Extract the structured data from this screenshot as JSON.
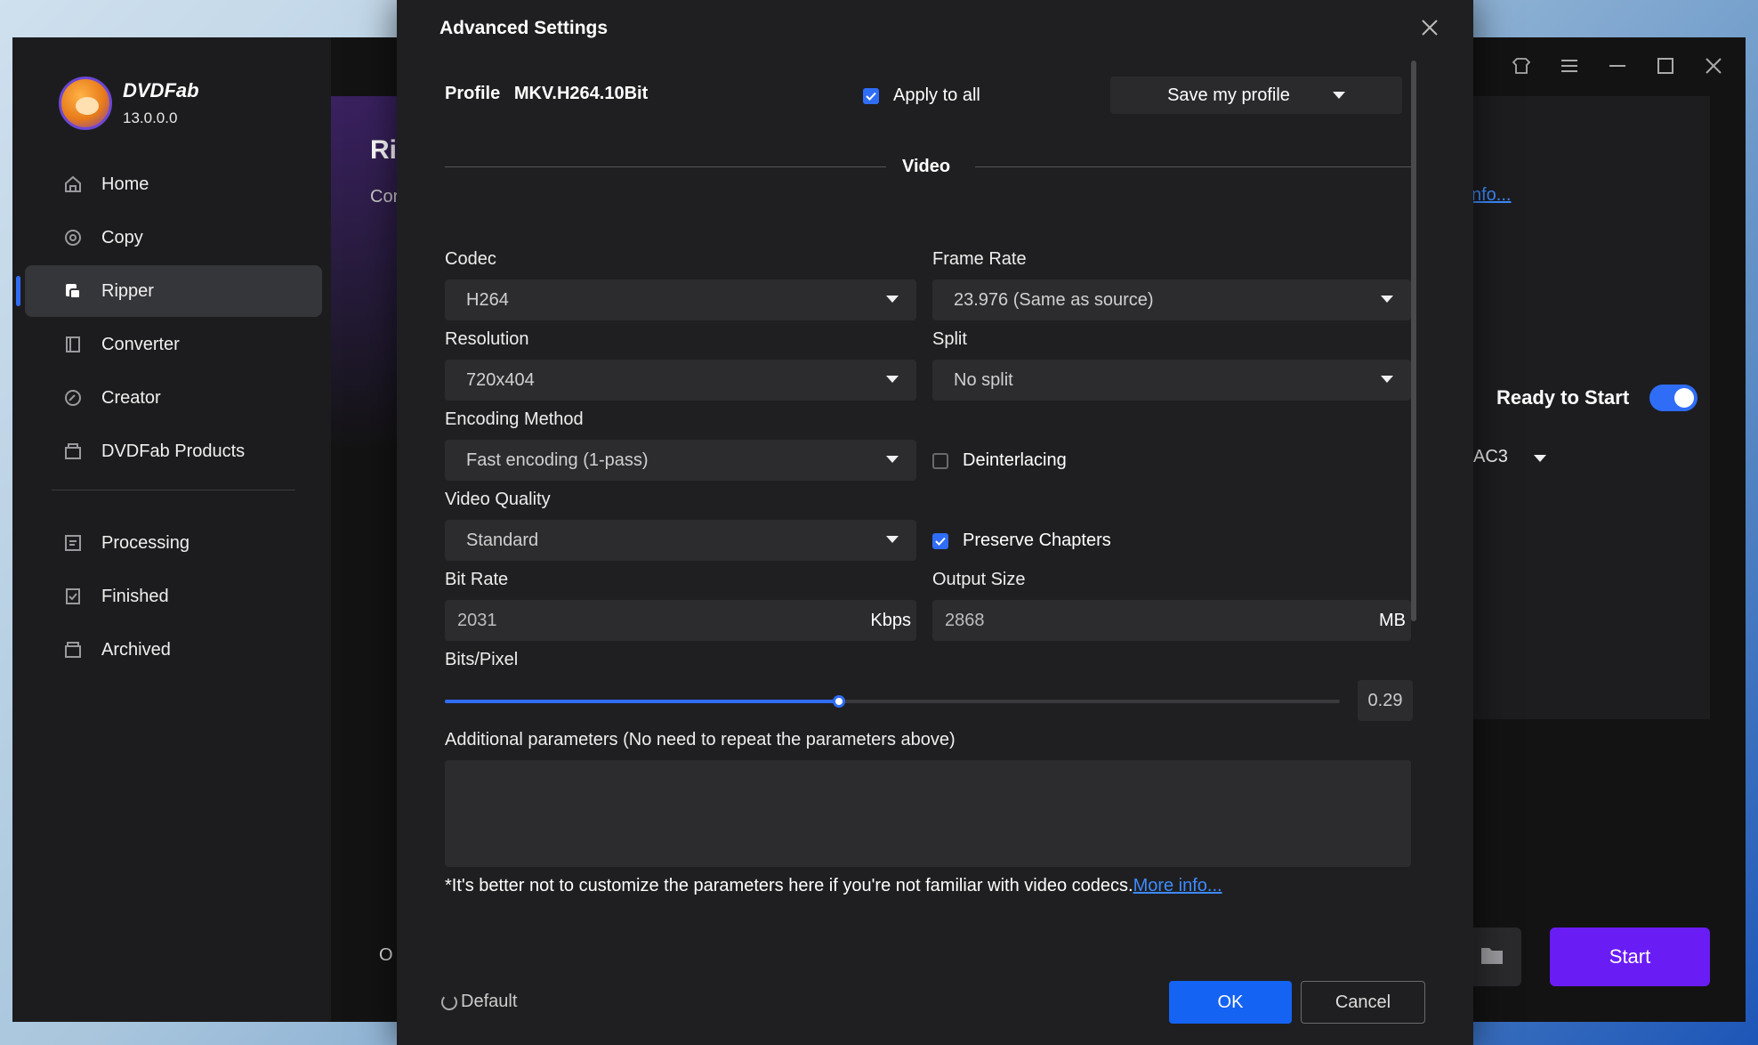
{
  "app": {
    "brand": "DVDFab",
    "version": "13.0.0.0"
  },
  "sidebar": {
    "items": [
      {
        "label": "Home",
        "icon": "home-icon"
      },
      {
        "label": "Copy",
        "icon": "copy-icon"
      },
      {
        "label": "Ripper",
        "icon": "ripper-icon",
        "active": true
      },
      {
        "label": "Converter",
        "icon": "converter-icon"
      },
      {
        "label": "Creator",
        "icon": "creator-icon"
      },
      {
        "label": "DVDFab Products",
        "icon": "products-icon"
      }
    ],
    "status_items": [
      {
        "label": "Processing",
        "icon": "processing-icon"
      },
      {
        "label": "Finished",
        "icon": "finished-icon"
      },
      {
        "label": "Archived",
        "icon": "archived-icon"
      }
    ]
  },
  "background": {
    "title_fragment": "Ri",
    "subtitle_fragment": "Cor",
    "bottom_fragment": "O",
    "info_link": "nfo...",
    "ready_to_start": "Ready to Start",
    "audio_fragment": "AC3",
    "start_button": "Start"
  },
  "dialog": {
    "title": "Advanced Settings",
    "profile_label": "Profile",
    "profile_name": "MKV.H264.10Bit",
    "apply_to_all": "Apply to all",
    "apply_to_all_checked": true,
    "save_profile": "Save my profile",
    "section_video": "Video",
    "codec": {
      "label": "Codec",
      "value": "H264"
    },
    "frame_rate": {
      "label": "Frame Rate",
      "value": "23.976 (Same as source)"
    },
    "resolution": {
      "label": "Resolution",
      "value": "720x404"
    },
    "split": {
      "label": "Split",
      "value": "No split"
    },
    "encoding_method": {
      "label": "Encoding Method",
      "value": "Fast encoding (1-pass)"
    },
    "deinterlacing": {
      "label": "Deinterlacing",
      "checked": false
    },
    "video_quality": {
      "label": "Video Quality",
      "value": "Standard"
    },
    "preserve_chapters": {
      "label": "Preserve Chapters",
      "checked": true
    },
    "bit_rate": {
      "label": "Bit Rate",
      "value": "2031",
      "unit": "Kbps"
    },
    "output_size": {
      "label": "Output Size",
      "value": "2868",
      "unit": "MB"
    },
    "bits_pixel": {
      "label": "Bits/Pixel",
      "value": "0.29",
      "slider_fraction": 0.44
    },
    "additional_params_label": "Additional parameters (No need to repeat the parameters above)",
    "note_text": "*It's better not to customize the parameters here if you're not familiar with video codecs.",
    "note_link": "More info...",
    "default_button": "Default",
    "ok_button": "OK",
    "cancel_button": "Cancel"
  },
  "colors": {
    "accent": "#2f6df6",
    "ok_button": "#1463f3",
    "start_button": "#6a1cf5",
    "link": "#3d8bff"
  }
}
